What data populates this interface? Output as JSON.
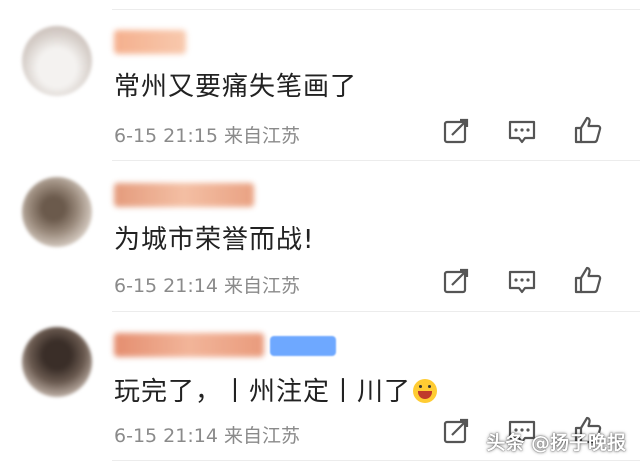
{
  "comments": [
    {
      "text": "常州又要痛失笔画了",
      "time": "6-15 21:15",
      "location": "来自江苏"
    },
    {
      "text": "为城市荣誉而战!",
      "time": "6-15 21:14",
      "location": "来自江苏"
    },
    {
      "text": "玩完了，丨州注定丨川了",
      "time": "6-15 21:14",
      "location": "来自江苏"
    }
  ],
  "watermark": "头条 @扬子晚报",
  "icons": {
    "forward": "share-edit-icon",
    "comment": "comment-icon",
    "like": "thumbs-up-icon"
  },
  "colors": {
    "text": "#222222",
    "meta": "#8a8a8a",
    "icon": "#555555",
    "divider": "#ececec"
  }
}
